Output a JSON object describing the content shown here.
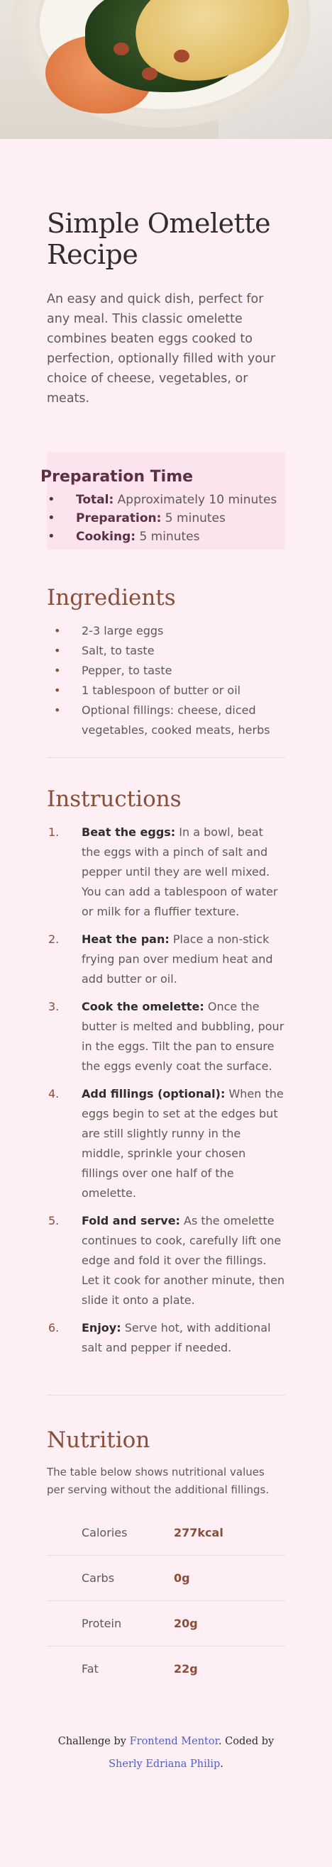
{
  "page": {
    "background": "#fdeff4"
  },
  "hero": {
    "image_description_icon": "omelette-image"
  },
  "title": "Simple Omelette Recipe",
  "intro": "An easy and quick dish, perfect for any meal. This classic omelette combines beaten eggs cooked to perfection, optionally filled with your choice of cheese, vegetables, or meats.",
  "prep": {
    "heading": "Preparation Time",
    "items": [
      {
        "label": "Total:",
        "value": " Approximately 10 minutes"
      },
      {
        "label": "Preparation:",
        "value": " 5 minutes"
      },
      {
        "label": "Cooking:",
        "value": " 5 minutes"
      }
    ]
  },
  "ingredients": {
    "heading": "Ingredients",
    "items": [
      "2-3 large eggs",
      "Salt, to taste",
      "Pepper, to taste",
      "1 tablespoon of butter or oil",
      "Optional fillings: cheese, diced vegetables, cooked meats, herbs"
    ]
  },
  "instructions": {
    "heading": "Instructions",
    "steps": [
      {
        "num": "1.",
        "label": "Beat the eggs:",
        "text": " In a bowl, beat the eggs with a pinch of salt and pepper until they are well mixed. You can add a tablespoon of water or milk for a fluffier texture."
      },
      {
        "num": "2.",
        "label": "Heat the pan:",
        "text": " Place a non-stick frying pan over medium heat and add butter or oil."
      },
      {
        "num": "3.",
        "label": "Cook the omelette:",
        "text": " Once the butter is melted and bubbling, pour in the eggs. Tilt the pan to ensure the eggs evenly coat the surface."
      },
      {
        "num": "4.",
        "label": "Add fillings (optional):",
        "text": " When the eggs begin to set at the edges but are still slightly runny in the middle, sprinkle your chosen fillings over one half of the omelette."
      },
      {
        "num": "5.",
        "label": "Fold and serve:",
        "text": " As the omelette continues to cook, carefully lift one edge and fold it over the fillings. Let it cook for another minute, then slide it onto a plate."
      },
      {
        "num": "6.",
        "label": "Enjoy:",
        "text": " Serve hot, with additional salt and pepper if needed."
      }
    ]
  },
  "nutrition": {
    "heading": "Nutrition",
    "description": "The table below shows nutritional values per serving without the additional fillings.",
    "rows": [
      {
        "label": "Calories",
        "value": "277kcal"
      },
      {
        "label": "Carbs",
        "value": "0g"
      },
      {
        "label": "Protein",
        "value": "20g"
      },
      {
        "label": "Fat",
        "value": "22g"
      }
    ]
  },
  "footer": {
    "prefix": "Challenge by ",
    "link1": "Frontend Mentor",
    "middle": ". Coded by ",
    "link2": "Sherly Edriana Philip",
    "suffix": "."
  }
}
